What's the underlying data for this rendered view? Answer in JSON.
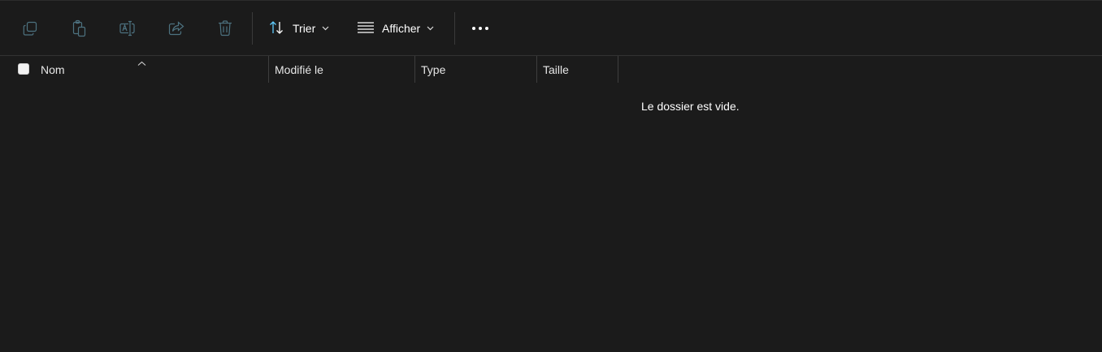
{
  "toolbar": {
    "icons": [
      {
        "name": "copy-icon",
        "enabled": false
      },
      {
        "name": "paste-icon",
        "enabled": false
      },
      {
        "name": "rename-icon",
        "enabled": false
      },
      {
        "name": "share-icon",
        "enabled": false
      },
      {
        "name": "delete-icon",
        "enabled": false
      }
    ],
    "sort_label": "Trier",
    "view_label": "Afficher",
    "more_icon": "more-horizontal-icon"
  },
  "columns": {
    "name": "Nom",
    "modified": "Modifié le",
    "type": "Type",
    "size": "Taille",
    "sorted_by": "Nom",
    "sort_direction": "ascending"
  },
  "content": {
    "empty_message": "Le dossier est vide."
  },
  "colors": {
    "background": "#1b1b1b",
    "disabled_icon": "#5d8a9c",
    "accent": "#60cdff",
    "text": "#ffffff"
  }
}
